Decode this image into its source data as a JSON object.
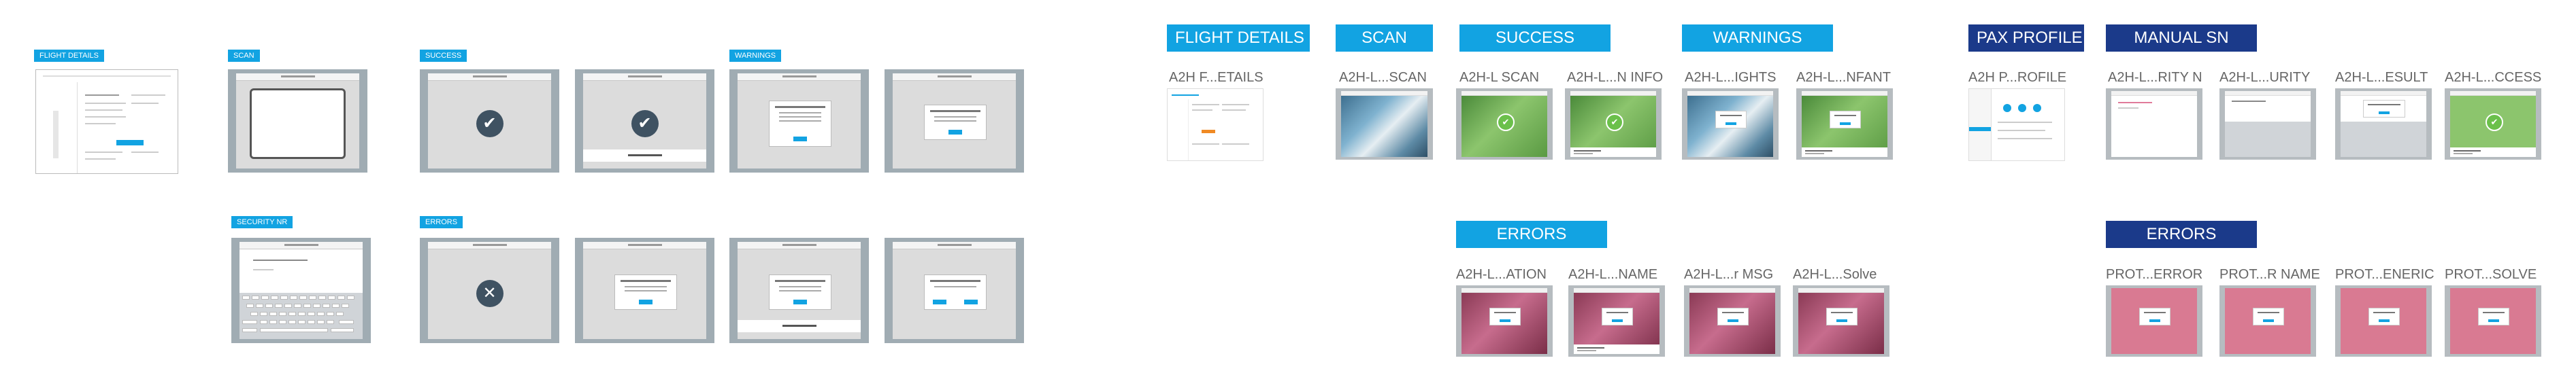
{
  "left": {
    "labels": {
      "flight_details": "FLIGHT DETAILS",
      "scan": "SCAN",
      "success": "SUCCESS",
      "warnings": "WARNINGS",
      "security_nr": "SECURITY NR",
      "errors": "ERRORS"
    },
    "check_symbol": "✔",
    "cross_symbol": "✕"
  },
  "middle": {
    "headers": {
      "flight_details": "FLIGHT DETAILS",
      "scan": "SCAN",
      "success": "SUCCESS",
      "warnings": "WARNINGS",
      "errors": "ERRORS"
    },
    "captions": {
      "flight_details": "A2H F...ETAILS",
      "scan": "A2H-L...SCAN",
      "success_1": "A2H-L SCAN",
      "success_2": "A2H-L...N INFO",
      "warnings_1": "A2H-L...IGHTS",
      "warnings_2": "A2H-L...NFANT",
      "errors_1": "A2H-L...ATION",
      "errors_2": "A2H-L...NAME",
      "errors_3": "A2H-L...r MSG",
      "errors_4": "A2H-L...Solve"
    }
  },
  "right": {
    "headers": {
      "pax_profile": "PAX PROFILE",
      "manual_sn": "MANUAL SN",
      "errors": "ERRORS"
    },
    "captions": {
      "pax_profile": "A2H P...ROFILE",
      "manual_1": "A2H-L...RITY N",
      "manual_2": "A2H-L...URITY",
      "manual_3": "A2H-L...ESULT",
      "manual_4": "A2H-L...CCESS",
      "errors_1": "PROT...ERROR",
      "errors_2": "PROT...R NAME",
      "errors_3": "PROT...ENERIC",
      "errors_4": "PROT...SOLVE"
    }
  },
  "colors": {
    "accent_light": "#12a3e2",
    "accent_dark": "#1b3a8a",
    "frame_gray": "#a0acb3",
    "success_green": "#6bc04b",
    "error_pink": "#d97a92"
  }
}
